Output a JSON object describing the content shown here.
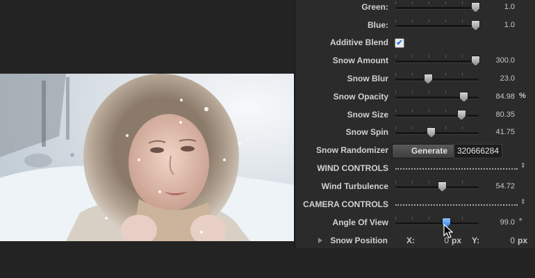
{
  "inspector": {
    "sliders": [
      {
        "label": "Green:",
        "value": "1.0",
        "pos": 0.95
      },
      {
        "label": "Blue:",
        "value": "1.0",
        "pos": 0.95
      },
      {
        "label": "Snow Amount",
        "value": "300.0",
        "pos": 0.95
      },
      {
        "label": "Snow Blur",
        "value": "23.0",
        "pos": 0.38
      },
      {
        "label": "Snow Opacity",
        "value": "84.98",
        "pos": 0.81,
        "unit": "%"
      },
      {
        "label": "Snow Size",
        "value": "80.35",
        "pos": 0.78
      },
      {
        "label": "Snow Spin",
        "value": "41.75",
        "pos": 0.42
      },
      {
        "label": "Wind Turbulence",
        "value": "54.72",
        "pos": 0.55
      },
      {
        "label": "Angle Of View",
        "value": "99.0",
        "pos": 0.6,
        "unit": "°"
      }
    ],
    "additive_blend": {
      "label": "Additive Blend",
      "checked": true
    },
    "snow_randomizer": {
      "label": "Snow Randomizer",
      "button": "Generate",
      "seed": "320666284"
    },
    "wind_controls": {
      "label": "WIND CONTROLS"
    },
    "camera_controls": {
      "label": "CAMERA CONTROLS"
    },
    "snow_position": {
      "label": "Snow Position",
      "x_label": "X:",
      "x_value": "0",
      "x_unit": "px",
      "y_label": "Y:",
      "y_value": "0",
      "y_unit": "px"
    }
  },
  "icons": {
    "checkmark": "✔",
    "updown": "⇕"
  }
}
